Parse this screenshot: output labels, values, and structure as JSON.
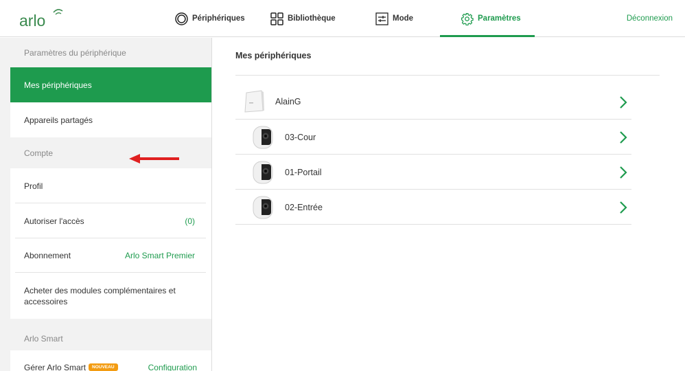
{
  "app": {
    "logo_text": "arlo"
  },
  "nav": {
    "items": [
      {
        "label": "Périphériques",
        "icon": "devices-icon"
      },
      {
        "label": "Bibliothèque",
        "icon": "library-grid-icon"
      },
      {
        "label": "Mode",
        "icon": "mode-sliders-icon"
      },
      {
        "label": "Paramètres",
        "icon": "gear-icon",
        "active": true
      }
    ],
    "logout": "Déconnexion"
  },
  "sidebar": {
    "device_section": "Paramètres du périphérique",
    "device_items": [
      "Mes périphériques",
      "Appareils partagés"
    ],
    "account_section": "Compte",
    "account_items": [
      {
        "label": "Profil",
        "value": ""
      },
      {
        "label": "Autoriser l'accès",
        "value": "(0)"
      },
      {
        "label": "Abonnement",
        "value": "Arlo Smart Premier"
      },
      {
        "label": "Acheter des modules complémentaires et accessoires",
        "value": ""
      }
    ],
    "smart_section": "Arlo Smart",
    "smart_item": {
      "label": "Gérer Arlo Smart",
      "badge": "NOUVEAU",
      "value": "Configuration"
    }
  },
  "main": {
    "title": "Mes périphériques",
    "devices": [
      {
        "name": "AlainG",
        "type": "base-station"
      },
      {
        "name": "03-Cour",
        "type": "camera"
      },
      {
        "name": "01-Portail",
        "type": "camera"
      },
      {
        "name": "02-Entrée",
        "type": "camera"
      }
    ]
  },
  "colors": {
    "accent": "#1e9b4e",
    "badge": "#f39c12",
    "annotation_arrow": "#e02020"
  }
}
